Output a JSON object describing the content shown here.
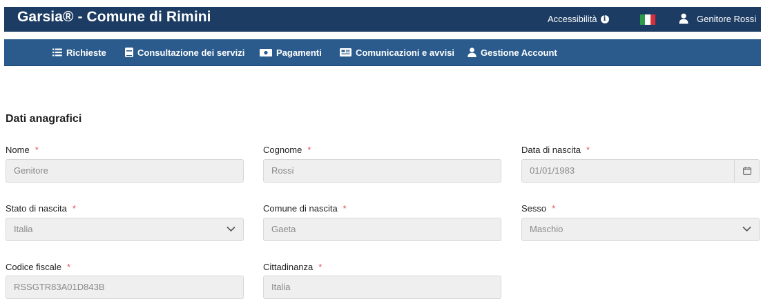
{
  "header": {
    "title": "Garsia® - Comune di Rimini",
    "accessibility_label": "Accessibilità",
    "user_name": "Genitore Rossi",
    "colors": {
      "topbar": "#1d3c63",
      "navbar": "#2a5b8c",
      "required": "#e0525c"
    }
  },
  "nav": {
    "items": [
      {
        "label": "Richieste",
        "icon": "list-icon"
      },
      {
        "label": "Consultazione dei servizi",
        "icon": "book-icon"
      },
      {
        "label": "Pagamenti",
        "icon": "money-icon"
      },
      {
        "label": "Comunicazioni e avvisi",
        "icon": "newspaper-icon"
      },
      {
        "label": "Gestione Account",
        "icon": "user-icon"
      }
    ]
  },
  "section": {
    "title": "Dati anagrafici"
  },
  "form": {
    "required_mark": "*",
    "nome": {
      "label": "Nome",
      "value": "Genitore"
    },
    "cognome": {
      "label": "Cognome",
      "value": "Rossi"
    },
    "data_nascita": {
      "label": "Data di nascita",
      "value": "01/01/1983"
    },
    "stato_nascita": {
      "label": "Stato di nascita",
      "value": "Italia"
    },
    "comune_nascita": {
      "label": "Comune di nascita",
      "value": "Gaeta"
    },
    "sesso": {
      "label": "Sesso",
      "value": "Maschio"
    },
    "codice_fiscale": {
      "label": "Codice fiscale",
      "value": "RSSGTR83A01D843B"
    },
    "cittadinanza": {
      "label": "Cittadinanza",
      "value": "Italia"
    }
  }
}
